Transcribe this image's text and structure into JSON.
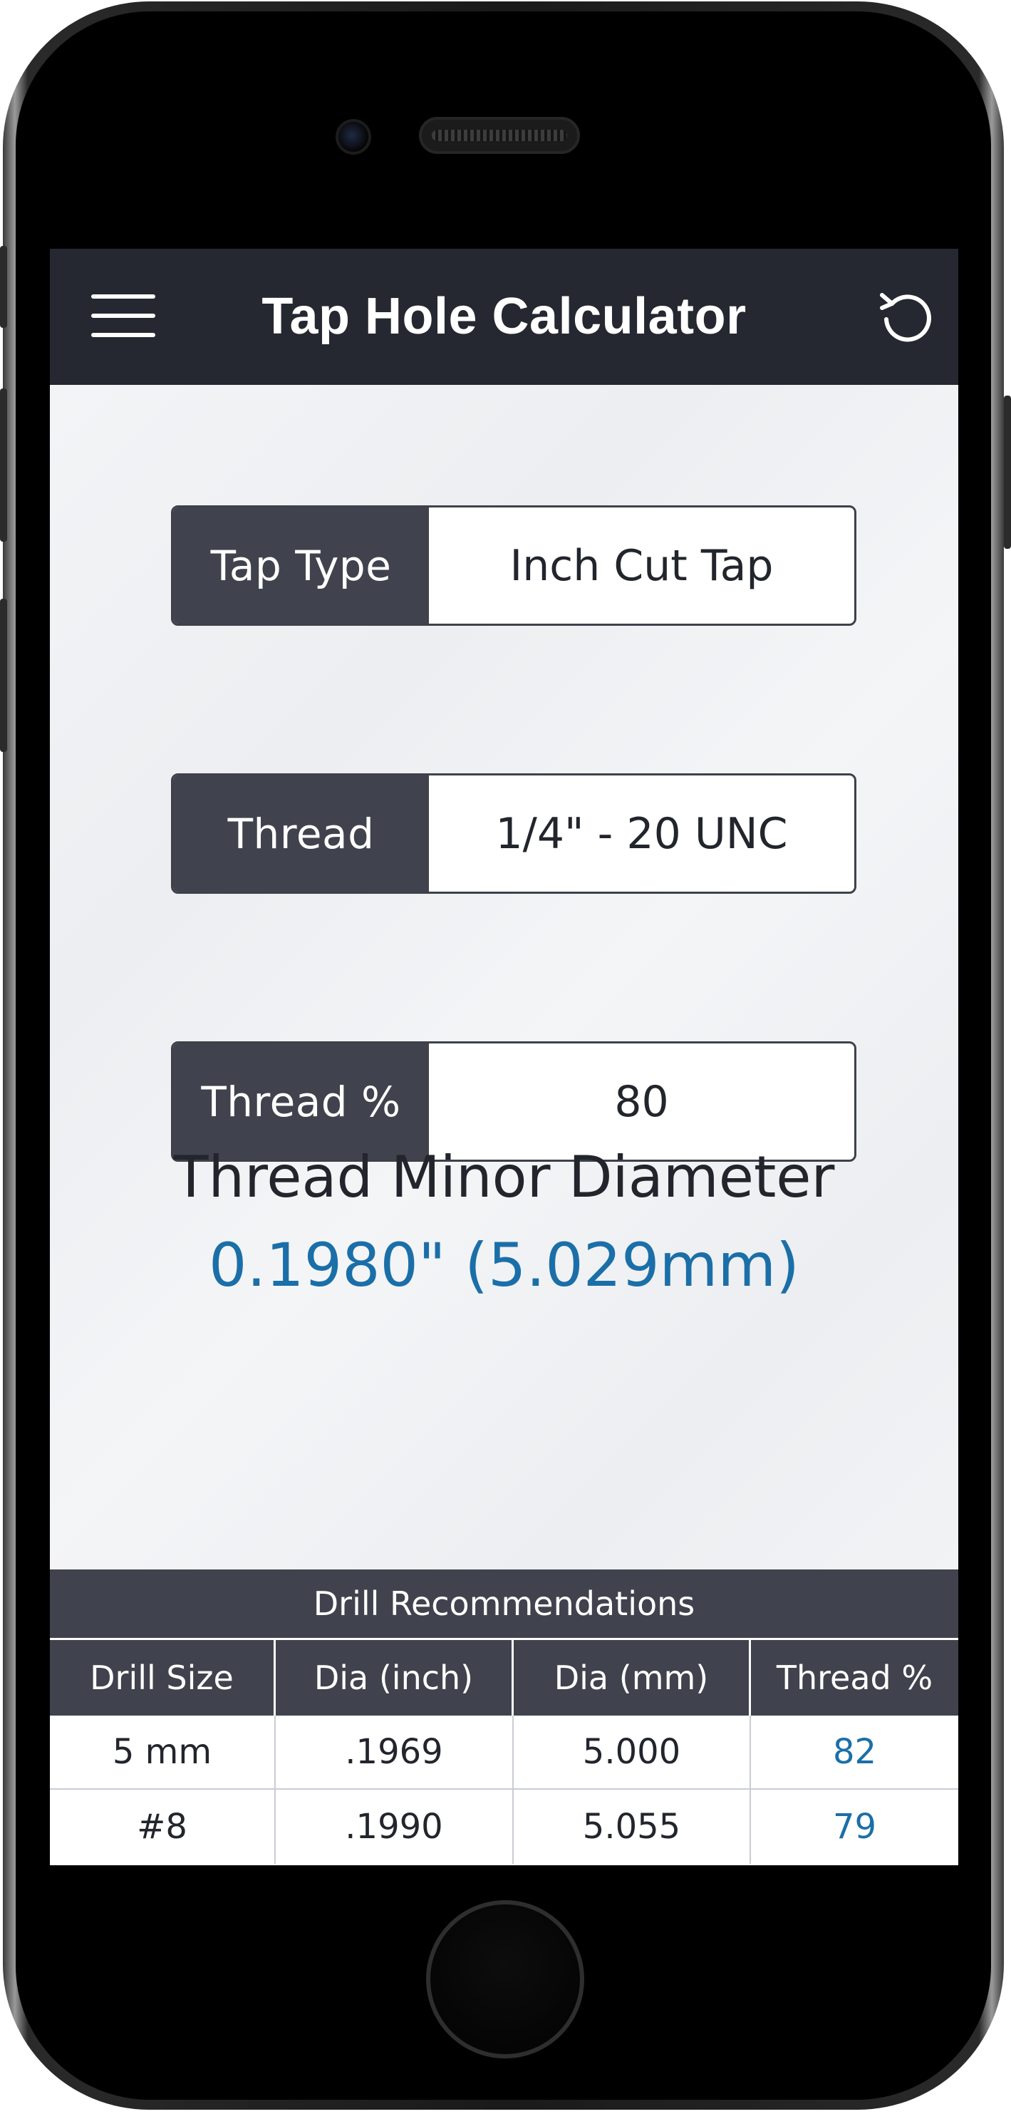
{
  "app": {
    "title": "Tap Hole Calculator"
  },
  "header": {
    "menu_icon": "hamburger-menu-icon",
    "reset_icon": "reset-icon"
  },
  "fields": [
    {
      "label": "Tap Type",
      "value": "Inch Cut Tap"
    },
    {
      "label": "Thread",
      "value": "1/4\" - 20 UNC"
    },
    {
      "label": "Thread %",
      "value": "80"
    }
  ],
  "result": {
    "title": "Thread Minor Diameter",
    "value": "0.1980\" (5.029mm)"
  },
  "drill_table": {
    "title": "Drill Recommendations",
    "columns": [
      "Drill Size",
      "Dia (inch)",
      "Dia (mm)",
      "Thread %"
    ],
    "rows": [
      {
        "size": "5 mm",
        "dia_inch": ".1969",
        "dia_mm": "5.000",
        "thread_pct": "82"
      },
      {
        "size": "#8",
        "dia_inch": ".1990",
        "dia_mm": "5.055",
        "thread_pct": "79"
      }
    ]
  },
  "colors": {
    "header_bg": "#252830",
    "label_bg": "#40434d",
    "accent": "#1b6fa8",
    "content_bg": "#eef0f3"
  }
}
